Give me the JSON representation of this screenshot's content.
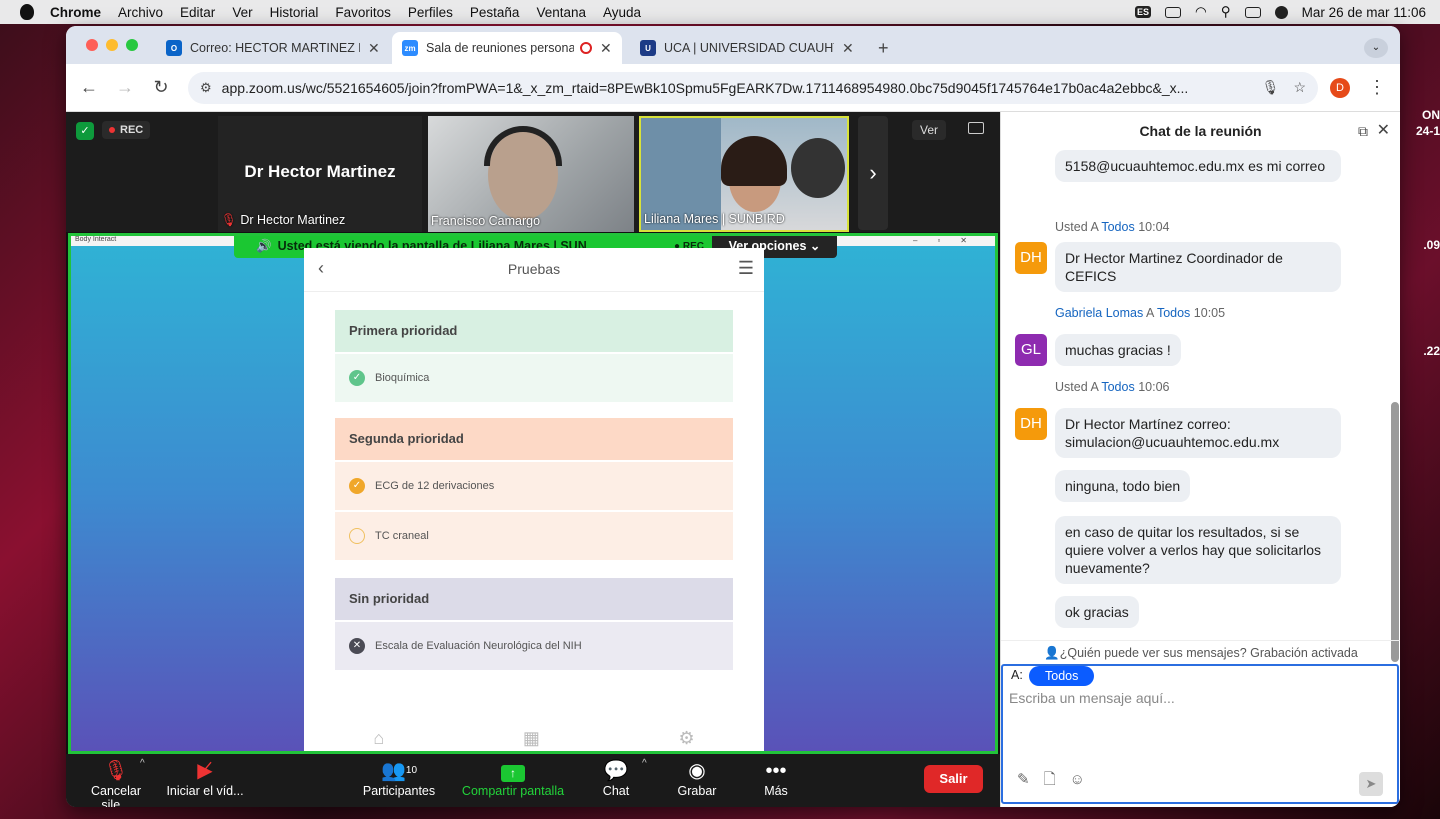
{
  "menubar": {
    "app": "Chrome",
    "items": [
      "Archivo",
      "Editar",
      "Ver",
      "Historial",
      "Favoritos",
      "Perfiles",
      "Pestaña",
      "Ventana",
      "Ayuda"
    ],
    "input_source": "ES",
    "datetime": "Mar 26 de mar  11:06"
  },
  "desktop_side": {
    "a": "ON",
    "b": "24-1",
    "c": ".09",
    "d": ".22"
  },
  "tabs": [
    {
      "title": "Correo: HECTOR MARTINEZ F",
      "icon": "outlook-icon"
    },
    {
      "title": "Sala de reuniones persona",
      "icon": "zoom-icon",
      "recording": true
    },
    {
      "title": "UCA | UNIVERSIDAD CUAUHT",
      "icon": "uca-icon"
    }
  ],
  "url": "app.zoom.us/wc/5521654605/join?fromPWA=1&_x_zm_rtaid=8PEwBk10Spmu5FgEARK7Dw.1711468954980.0bc75d9045f1745764e17b0ac4a2ebbc&_x...",
  "profile_initial": "D",
  "zoom": {
    "rec_label": "REC",
    "ver_label": "Ver",
    "participants": [
      {
        "name": "Dr Hector Martinez",
        "big_label": "Dr Hector Martinez",
        "muted": true
      },
      {
        "name": "Francisco Camargo"
      },
      {
        "name": "Liliana Mares | SUNBIRD"
      }
    ],
    "share_banner": "Usted está viendo la pantalla de  Liliana Mares | SUN...",
    "banner_rec": "REC",
    "ver_opciones": "Ver opciones",
    "app_window_title": "Body Interact"
  },
  "phone": {
    "title": "Pruebas",
    "sections": [
      {
        "title": "Primera prioridad",
        "color": "#d8f0e2",
        "item_bg": "#eef8f2",
        "items": [
          {
            "label": "Bioquímica",
            "state": "checked",
            "check_color": "#5fc58b"
          }
        ]
      },
      {
        "title": "Segunda prioridad",
        "color": "#fdd9c6",
        "item_bg": "#fdeee5",
        "items": [
          {
            "label": "ECG de 12 derivaciones",
            "state": "checked",
            "check_color": "#f0a72a"
          },
          {
            "label": "TC craneal",
            "state": "empty",
            "check_color": "#f0c060"
          }
        ]
      },
      {
        "title": "Sin prioridad",
        "color": "#dcdbe8",
        "item_bg": "#ebeaf2",
        "items": [
          {
            "label": "Escala de Evaluación Neurológica del NIH",
            "state": "x",
            "check_color": "#4b4b55"
          }
        ]
      }
    ]
  },
  "controls": {
    "mute": "Cancelar sile...",
    "video": "Iniciar el víd...",
    "participants": "Participantes",
    "participants_count": "10",
    "share": "Compartir pantalla",
    "chat": "Chat",
    "record": "Grabar",
    "more": "Más",
    "leave": "Salir"
  },
  "chat": {
    "title": "Chat de la reunión",
    "messages": [
      {
        "type": "bubble",
        "text": "5158@ucuauhtemoc.edu.mx es mi correo"
      },
      {
        "type": "meta",
        "sender": "Usted",
        "to_word": "A",
        "to": "Todos",
        "time": "10:04"
      },
      {
        "type": "bubble",
        "initials": "DH",
        "text": "Dr Hector Martinez Coordinador de CEFICS"
      },
      {
        "type": "meta",
        "sender": "Gabriela Lomas",
        "to_word": "A",
        "to": "Todos",
        "time": "10:05"
      },
      {
        "type": "bubble",
        "initials": "GL",
        "text": "muchas gracias !"
      },
      {
        "type": "meta",
        "sender": "Usted",
        "to_word": "A",
        "to": "Todos",
        "time": "10:06"
      },
      {
        "type": "bubble",
        "initials": "DH",
        "text": "Dr Hector Martínez  correo: simulacion@ucuauhtemoc.edu.mx"
      },
      {
        "type": "bubble",
        "text": "ninguna, todo bien"
      },
      {
        "type": "bubble",
        "text": "en caso de quitar los resultados, si se quiere volver a verlos hay que solicitarlos nuevamente?"
      },
      {
        "type": "bubble",
        "text": "ok gracias"
      }
    ],
    "who_sees": "¿Quién puede ver sus mensajes? Grabación activada",
    "to_label": "A:",
    "to_value": "Todos",
    "placeholder": "Escriba un mensaje aquí..."
  },
  "colors": {
    "zoom_green": "#1bc732",
    "zoom_blue": "#0b5cff",
    "leave_red": "#e02828",
    "avatar_dh": "#f59a0b",
    "avatar_gl": "#8e2bb0"
  }
}
